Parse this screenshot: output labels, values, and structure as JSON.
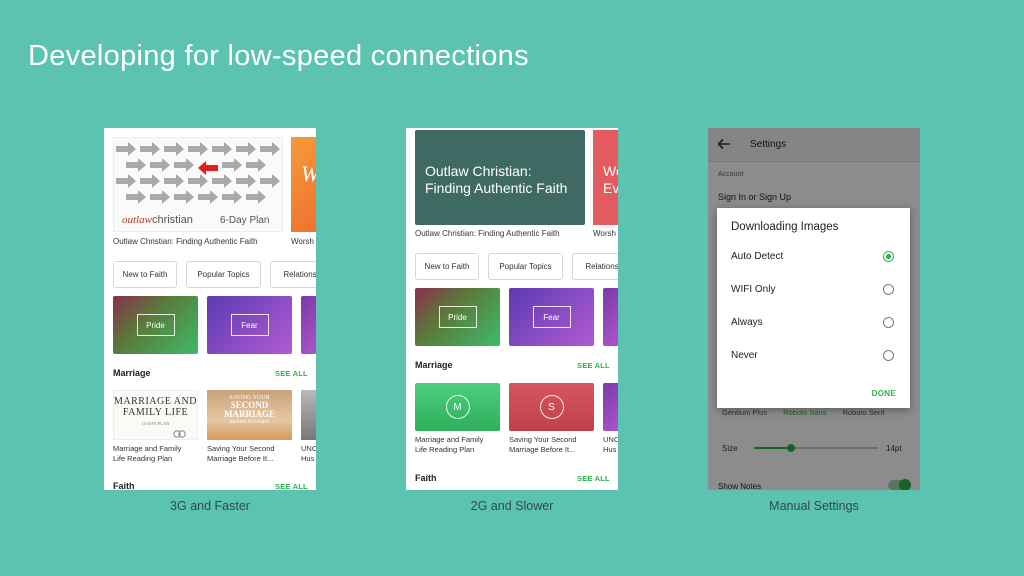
{
  "slide": {
    "title": "Developing for low-speed connections",
    "captions": [
      "3G and Faster",
      "2G and Slower",
      "Manual Settings"
    ]
  },
  "phone1": {
    "banner_brand": "outlaw",
    "banner_brand2": "christian",
    "banner_plan": "6-Day Plan",
    "banner_caption": "Outlaw Christian: Finding Authentic Faith",
    "banner2_caption": "Worsh",
    "chips": [
      "New to Faith",
      "Popular Topics",
      "Relations"
    ],
    "tiles": [
      "Pride",
      "Fear"
    ],
    "section1": "Marriage",
    "see_all": "SEE ALL",
    "book1_title_line1": "MARRIAGE AND",
    "book1_title_line2": "FAMILY LIFE",
    "book1_sub": "14-DAY PLAN",
    "book2_line1": "SAVING YOUR",
    "book2_line2": "SECOND",
    "book2_line3": "MARRIAGE",
    "book2_line4": "BEFORE IT STARTS",
    "item1_l1": "Marriage and Family",
    "item1_l2": "Life Reading Plan",
    "item2_l1": "Saving Your Second",
    "item2_l2": "Marriage Before It...",
    "item3_l1": "UNC",
    "item3_l2": "Hus",
    "section2": "Faith"
  },
  "phone2": {
    "banner_title_l1": "Outlaw Christian:",
    "banner_title_l2": "Finding Authentic Faith",
    "banner2_l1": "We",
    "banner2_l2": "Ev",
    "banner_caption": "Outlaw Christian: Finding Authentic Faith",
    "banner2_caption": "Worsh",
    "chips": [
      "New to Faith",
      "Popular Topics",
      "Relations"
    ],
    "tiles": [
      "Pride",
      "Fear"
    ],
    "section1": "Marriage",
    "see_all": "SEE ALL",
    "circle1": "M",
    "circle2": "S",
    "item1_l1": "Marriage and Family",
    "item1_l2": "Life Reading Plan",
    "item2_l1": "Saving Your Second",
    "item2_l2": "Marriage Before It...",
    "item3_l1": "UNC",
    "item3_l2": "Hus",
    "section2": "Faith"
  },
  "phone3": {
    "toolbar_title": "Settings",
    "account_header": "Account",
    "sign_in": "Sign In or Sign Up",
    "dialog_title": "Downloading Images",
    "options": [
      "Auto Detect",
      "WIFI Only",
      "Always",
      "Never"
    ],
    "selected_option": "Auto Detect",
    "done": "DONE",
    "fonts_row": [
      "Gentium Plus",
      "Roboto Sans",
      "Roboto Serif"
    ],
    "size_label": "Size",
    "size_value": "14pt",
    "size_level_fraction": 0.3,
    "show_notes": "Show Notes",
    "accent_color": "#2bb24c"
  }
}
